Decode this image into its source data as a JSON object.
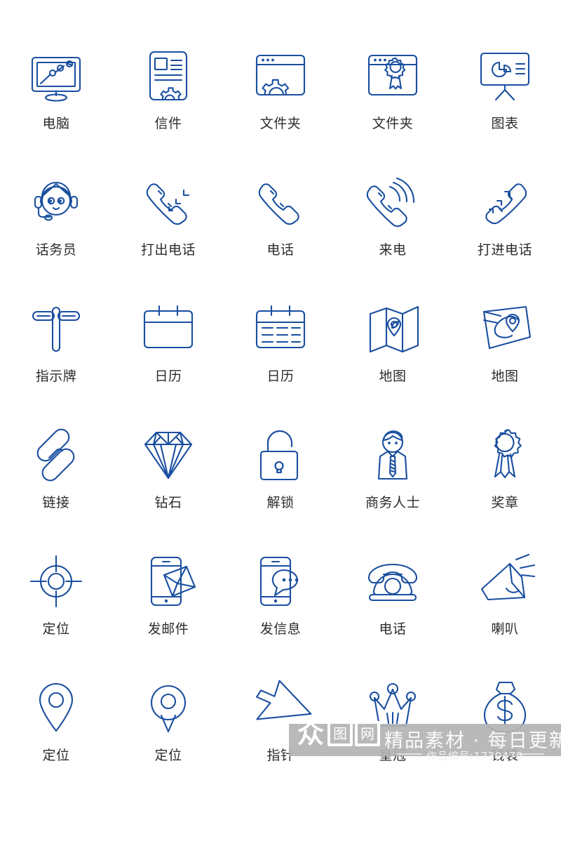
{
  "page": {
    "background": "#ffffff",
    "icon_color": "#1a4fa0",
    "label_color": "#2b2b2b",
    "columns": 5,
    "rows": 6
  },
  "icons": [
    {
      "icon": "computer-monitor-chart-icon",
      "label": "电脑"
    },
    {
      "icon": "document-gear-letter-icon",
      "label": "信件"
    },
    {
      "icon": "browser-window-gear-icon",
      "label": "文件夹"
    },
    {
      "icon": "browser-window-badge-icon",
      "label": "文件夹"
    },
    {
      "icon": "presentation-board-pie-chart-icon",
      "label": "图表"
    },
    {
      "icon": "headset-operator-icon",
      "label": "话务员"
    },
    {
      "icon": "phone-outgoing-call-icon",
      "label": "打出电话"
    },
    {
      "icon": "phone-handset-icon",
      "label": "电话"
    },
    {
      "icon": "phone-incoming-ring-icon",
      "label": "来电"
    },
    {
      "icon": "phone-incoming-call-icon",
      "label": "打进电话"
    },
    {
      "icon": "signpost-icon",
      "label": "指示牌"
    },
    {
      "icon": "calendar-blank-icon",
      "label": "日历"
    },
    {
      "icon": "calendar-lines-icon",
      "label": "日历"
    },
    {
      "icon": "folded-map-pin-icon",
      "label": "地图"
    },
    {
      "icon": "map-route-pin-icon",
      "label": "地图"
    },
    {
      "icon": "chain-link-icon",
      "label": "链接"
    },
    {
      "icon": "diamond-icon",
      "label": "钻石"
    },
    {
      "icon": "unlock-padlock-icon",
      "label": "解锁"
    },
    {
      "icon": "businessman-icon",
      "label": "商务人士"
    },
    {
      "icon": "award-ribbon-icon",
      "label": "奖章"
    },
    {
      "icon": "crosshair-target-icon",
      "label": "定位"
    },
    {
      "icon": "phone-send-mail-icon",
      "label": "发邮件"
    },
    {
      "icon": "phone-send-message-icon",
      "label": "发信息"
    },
    {
      "icon": "rotary-telephone-icon",
      "label": "电话"
    },
    {
      "icon": "megaphone-icon",
      "label": "喇叭"
    },
    {
      "icon": "map-pin-round-icon",
      "label": "定位"
    },
    {
      "icon": "map-pin-teardrop-icon",
      "label": "定位"
    },
    {
      "icon": "cursor-arrow-icon",
      "label": "指针"
    },
    {
      "icon": "crown-icon",
      "label": "皇冠"
    },
    {
      "icon": "money-bag-icon",
      "label": "钱袋"
    }
  ],
  "watermark": {
    "logo_zhong": "众",
    "logo_tu": "图",
    "logo_wang": "网",
    "slogan": "精品素材 · 每日更新",
    "code": "作品编号:1730479",
    "band_color": "#b3b3b3",
    "text_color": "#ffffff"
  }
}
